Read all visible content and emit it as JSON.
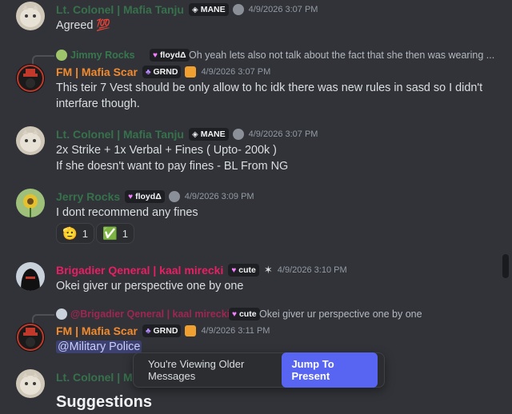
{
  "colors": {
    "background": "#313338",
    "green_name": "#3ba55c",
    "orange_name": "#f28a2e",
    "crimson_name": "#e91e63",
    "accent": "#5865f2"
  },
  "messages": [
    {
      "author": "Lt. Colonel | Mafia Tanju",
      "tag": "MANE",
      "tag_icon": "diamond-move-icon",
      "timestamp": "4/9/2026 3:07 PM",
      "lines": [
        "Agreed 💯"
      ]
    },
    {
      "reply_to": {
        "author": "Jimmy Rocks",
        "tag": "floydΔ",
        "text": "Oh yeah lets also not talk about the fact that she then was wearing ..."
      },
      "author": "FM | Mafia Scar",
      "tag": "GRND",
      "timestamp": "4/9/2026 3:07 PM",
      "lines": [
        "This teir 7 Vest should be only allow to hc idk there was new rules in sasd so I didn't",
        "interfare though."
      ]
    },
    {
      "author": "Lt. Colonel | Mafia Tanju",
      "tag": "MANE",
      "timestamp": "4/9/2026 3:07 PM",
      "lines": [
        "2x Strike + 1x Verbal + Fines ( Upto- 200k )",
        "If she doesn't want to pay fines - BL From NG"
      ]
    },
    {
      "author": "Jerry Rocks",
      "tag": "floydΔ",
      "timestamp": "4/9/2026 3:09 PM",
      "lines": [
        "I dont recommend any fines"
      ],
      "reactions": [
        {
          "emoji": "🫡",
          "count": "1"
        },
        {
          "emoji": "✅",
          "count": "1"
        }
      ]
    },
    {
      "author": "Brigadier Qeneral | kaal mirecki",
      "tag": "cute",
      "timestamp": "4/9/2026 3:10 PM",
      "lines": [
        "Okei giver ur perspective one by one"
      ]
    },
    {
      "reply_to": {
        "author": "@Brigadier Qeneral | kaal mirecki",
        "tag": "cute",
        "text": "Okei giver ur perspective one by one"
      },
      "author": "FM | Mafia Scar",
      "tag": "GRND",
      "timestamp": "4/9/2026 3:11 PM",
      "mention": "@Military Police"
    },
    {
      "author": "Lt. Colonel | Ma",
      "partial_title": "Suggestions"
    }
  ],
  "banner": {
    "label": "You're Viewing Older Messages",
    "button": "Jump To Present"
  }
}
